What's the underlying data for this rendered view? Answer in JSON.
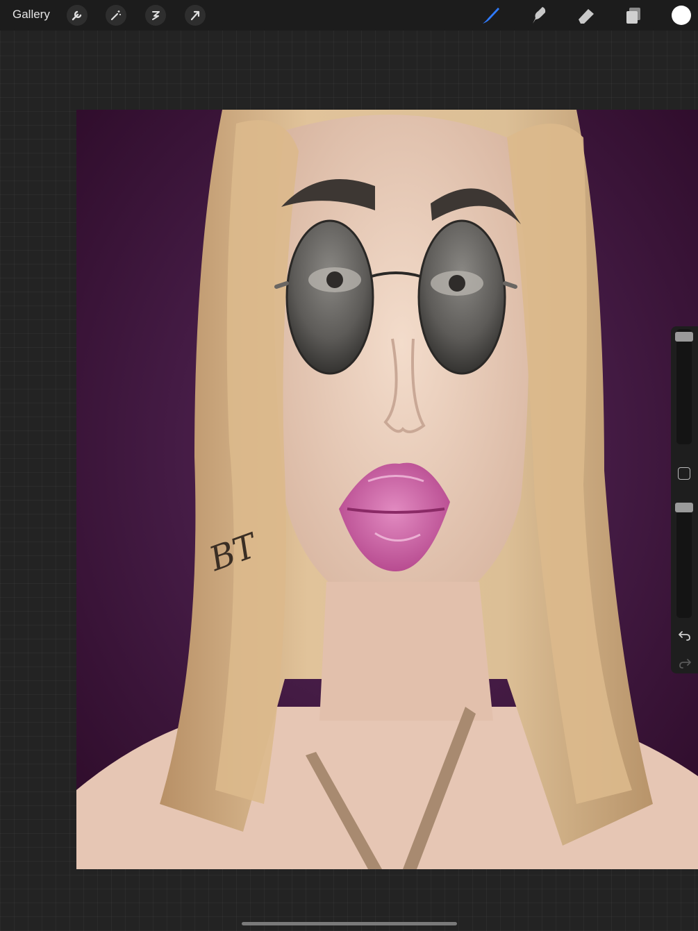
{
  "topbar": {
    "gallery_label": "Gallery",
    "left_tools": [
      "wrench-icon",
      "magic-wand-icon",
      "selection-icon",
      "transform-arrow-icon"
    ],
    "right_tools": [
      "brush-icon",
      "smudge-icon",
      "eraser-icon",
      "layers-icon"
    ],
    "active_tool": "brush-icon",
    "accent_color": "#2f7bff",
    "current_color": "#ffffff"
  },
  "sidebar": {
    "brush_size_level": 0.0,
    "opacity_level": 0.0,
    "icons": [
      "modify-square-icon",
      "undo-icon",
      "redo-icon"
    ]
  },
  "canvas": {
    "background_color": "#3a1035",
    "hair_color": "#d9b98d",
    "lip_color": "#c8589e",
    "signature_text": "BT"
  }
}
